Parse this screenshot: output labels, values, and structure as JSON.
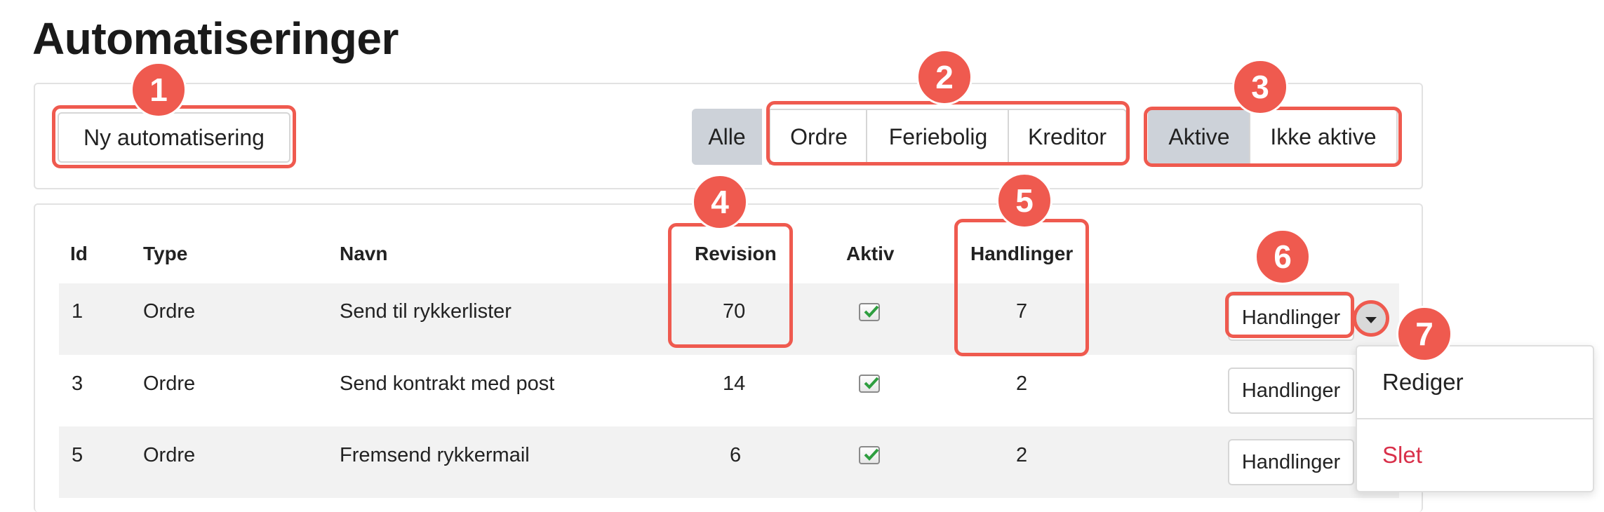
{
  "page": {
    "title": "Automatiseringer"
  },
  "toolbar": {
    "new_button": "Ny automatisering",
    "type_filters": [
      "Alle",
      "Ordre",
      "Feriebolig",
      "Kreditor"
    ],
    "status_filters": [
      "Aktive",
      "Ikke aktive"
    ],
    "active_type": "Alle",
    "active_status": "Aktive"
  },
  "table": {
    "headers": [
      "Id",
      "Type",
      "Navn",
      "Revision",
      "Aktiv",
      "Handlinger"
    ],
    "rows": [
      {
        "id": "1",
        "type": "Ordre",
        "name": "Send til rykkerlister",
        "revision": "70",
        "active": true,
        "actions": "7",
        "button": "Handlinger"
      },
      {
        "id": "3",
        "type": "Ordre",
        "name": "Send kontrakt med post",
        "revision": "14",
        "active": true,
        "actions": "2",
        "button": "Handlinger"
      },
      {
        "id": "5",
        "type": "Ordre",
        "name": "Fremsend rykkermail",
        "revision": "6",
        "active": true,
        "actions": "2",
        "button": "Handlinger"
      }
    ]
  },
  "dropdown": {
    "items": [
      "Rediger",
      "Slet"
    ]
  },
  "annotations": [
    "1",
    "2",
    "3",
    "4",
    "5",
    "6",
    "7"
  ],
  "colors": {
    "highlight": "#ef5a4f",
    "active_segment": "#cdd2d9",
    "delete": "#d9304a",
    "check": "#2e9e3f"
  }
}
